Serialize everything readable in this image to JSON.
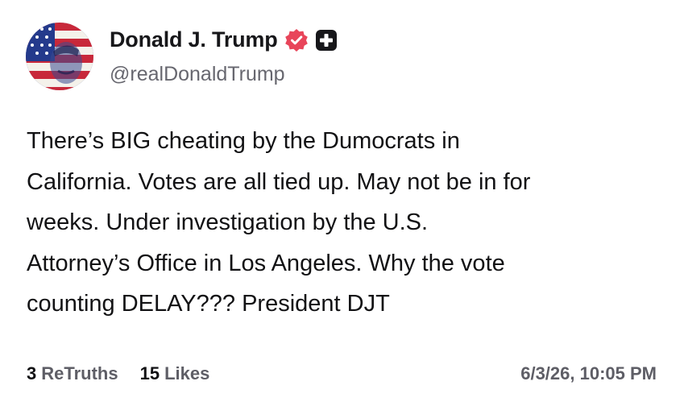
{
  "post": {
    "author": {
      "display_name": "Donald J. Trump",
      "handle": "@realDonaldTrump",
      "verified_icon": "verified-badge-icon",
      "plus_icon": "plus-badge-icon",
      "accent_color": "#e8455a"
    },
    "text": "There’s BIG cheating by the Dumocrats in\nCalifornia. Votes are all tied up. May not be in for\nweeks. Under investigation by the U.S.\nAttorney’s Office in Los Angeles. Why the vote\ncounting DELAY??? President DJT",
    "stats": {
      "retruths_count": "3",
      "retruths_label": "ReTruths",
      "likes_count": "15",
      "likes_label": "Likes"
    },
    "timestamp": "6/3/26, 10:05 PM"
  }
}
